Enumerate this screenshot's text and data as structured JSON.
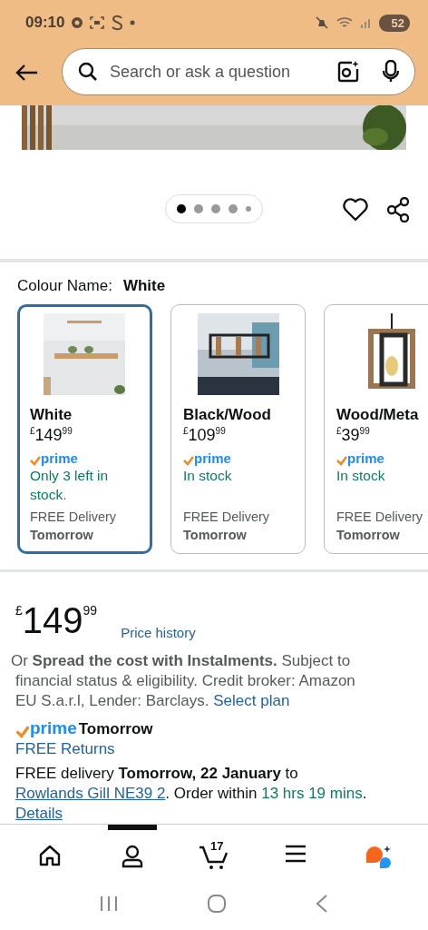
{
  "status_bar": {
    "time": "09:10",
    "battery": "52"
  },
  "search": {
    "placeholder": "Search or ask a question"
  },
  "carousel": {
    "dots": [
      {
        "selected": true
      },
      {
        "selected": false
      },
      {
        "selected": false
      },
      {
        "selected": false
      },
      {
        "selected": false
      }
    ]
  },
  "colour": {
    "label": "Colour Name:",
    "value": "White"
  },
  "variants": [
    {
      "name": "White",
      "currency": "£",
      "whole": "149",
      "fraction": "99",
      "prime": "prime",
      "stock": "Only 3 left in stock.",
      "delivery": "FREE Delivery",
      "day": "Tomorrow",
      "selected": true
    },
    {
      "name": "Black/Wood",
      "currency": "£",
      "whole": "109",
      "fraction": "99",
      "prime": "prime",
      "stock": "In stock",
      "delivery": "FREE Delivery",
      "day": "Tomorrow",
      "selected": false
    },
    {
      "name": "Wood/Meta",
      "currency": "£",
      "whole": "39",
      "fraction": "99",
      "prime": "prime",
      "stock": "In stock",
      "delivery": "FREE Delivery",
      "day": "Tomorrow",
      "selected": false
    }
  ],
  "price": {
    "currency": "£",
    "whole": "149",
    "fraction": "99",
    "history_link": "Price history"
  },
  "instalments": {
    "text": "Or **Spread the cost with Instalments.** Subject to financial status & eligibility. Credit broker: Amazon EU S.a.r.l, Lender: Barclays.",
    "link": "Select plan"
  },
  "prime_delivery": {
    "prime": "prime",
    "day": "Tomorrow",
    "returns": "FREE Returns"
  },
  "delivery": {
    "parts": [
      {
        "kind": "text",
        "text": "FREE delivery **Tomorrow, 22 January** to "
      },
      {
        "kind": "link",
        "text": "Rowlands Gill NE39 2"
      },
      {
        "kind": "text",
        "text": ". Order within "
      },
      {
        "kind": "countdown",
        "text": "13 hrs 19 mins"
      },
      {
        "kind": "text",
        "text": ". "
      },
      {
        "kind": "link",
        "text": "Details"
      }
    ]
  },
  "bottom_nav": [
    {
      "kind": "home",
      "selected": false
    },
    {
      "kind": "account",
      "selected": true
    },
    {
      "kind": "cart",
      "count": "17",
      "selected": false
    },
    {
      "kind": "menu",
      "selected": false
    },
    {
      "kind": "assistant",
      "selected": false
    }
  ]
}
